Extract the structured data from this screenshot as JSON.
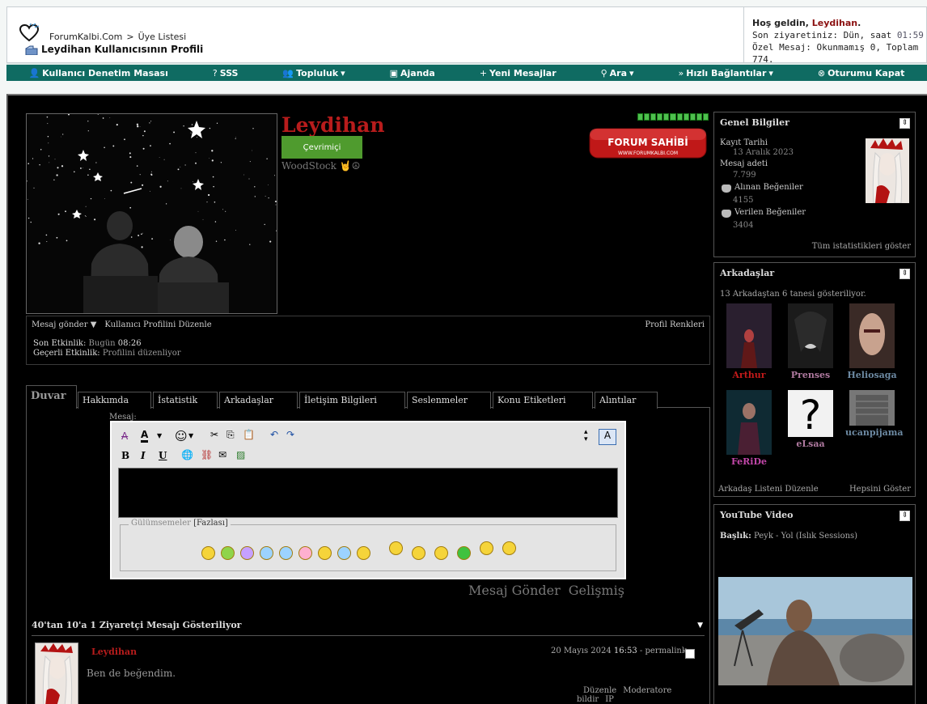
{
  "header": {
    "breadcrumb_site": "ForumKalbi.Com",
    "breadcrumb_sep": ">",
    "breadcrumb_page": "Üye Listesi",
    "page_title": "Leydihan Kullanıcısının Profili",
    "welcome_prefix": "Hoş geldin, ",
    "welcome_user": "Leydihan",
    "welcome_suffix": ".",
    "last_visit_label": "Son ziyaretiniz: Dün, saat ",
    "last_visit_time": "01:59",
    "pm_text": "Özel Mesaj: Okunmamış 0, Toplam 774."
  },
  "nav": [
    {
      "icon": "user-icon",
      "glyph": "👤",
      "label": "Kullanıcı Denetim Masası",
      "caret": ""
    },
    {
      "icon": "question-icon",
      "glyph": "?",
      "label": "SSS",
      "caret": ""
    },
    {
      "icon": "community-icon",
      "glyph": "👥",
      "label": "Topluluk",
      "caret": "▾"
    },
    {
      "icon": "calendar-icon",
      "glyph": "▣",
      "label": "Ajanda",
      "caret": ""
    },
    {
      "icon": "plus-icon",
      "glyph": "+",
      "label": "Yeni Mesajlar",
      "caret": ""
    },
    {
      "icon": "search-icon",
      "glyph": "⚲",
      "label": "Ara",
      "caret": "▾"
    },
    {
      "icon": "fast-forward-icon",
      "glyph": "»",
      "label": "Hızlı Bağlantılar",
      "caret": "▾"
    },
    {
      "icon": "logout-icon",
      "glyph": "⊗",
      "label": "Oturumu Kapat",
      "caret": ""
    }
  ],
  "profile": {
    "username": "Leydihan",
    "online_label": "Çevrimiçi",
    "status_text": "WoodStock 🤘☮",
    "badge_text": "FORUM SAHİBİ",
    "badge_url": "WWW.FORUMKALBI.COM",
    "send_message": "Mesaj gönder",
    "edit_profile": "Kullanıcı Profilini Düzenle",
    "profile_colors": "Profil Renkleri",
    "last_activity_label": "Son Etkinlik:",
    "last_activity_day": "Bugün",
    "last_activity_time": "08:26",
    "current_activity_label": "Geçerli Etkinlik:",
    "current_activity_value": "Profilini düzenliyor"
  },
  "tabs": [
    {
      "label": "Duvar"
    },
    {
      "label": "Hakkımda"
    },
    {
      "label": "İstatistik"
    },
    {
      "label": "Arkadaşlar"
    },
    {
      "label": "İletişim Bilgileri"
    },
    {
      "label": "Seslenmeler"
    },
    {
      "label": "Konu Etiketleri"
    },
    {
      "label": "Alıntılar"
    }
  ],
  "editor": {
    "message_label": "Mesaj:",
    "smilies_legend": "Gülümsemeler",
    "smilies_more": "[Fazlası]",
    "submit": "Mesaj Gönder",
    "advanced": "Gelişmiş"
  },
  "visitor_messages": {
    "header": "40'tan 10'a 1 Ziyaretçi Mesajı Gösteriliyor",
    "item": {
      "user": "Leydihan",
      "date": "20 Mayıs 2024",
      "time": "16:53",
      "permalink": "- permalink",
      "text": "Ben de beğendim.",
      "edit": "Düzenle",
      "report": "Moderatore bildir",
      "ip": "IP"
    }
  },
  "general": {
    "title": "Genel Bilgiler",
    "reg_label": "Kayıt Tarihi",
    "reg_value": "13 Aralık 2023",
    "posts_label": "Mesaj adeti",
    "posts_value": "7.799",
    "likes_recv_label": "Alınan Beğeniler",
    "likes_recv_value": "4155",
    "likes_given_label": "Verilen Beğeniler",
    "likes_given_value": "3404",
    "all_stats": "Tüm istatistikleri göster"
  },
  "friends": {
    "title": "Arkadaşlar",
    "subtitle": "13 Arkadaştan 6 tanesi gösteriliyor.",
    "list": [
      {
        "name": "Arthur",
        "color": "#c21a1a"
      },
      {
        "name": "Prenses",
        "color": "#b07aa0"
      },
      {
        "name": "Heliosaga",
        "color": "#6d8aa3"
      },
      {
        "name": "FeRiDe",
        "color": "#c247a9"
      },
      {
        "name": "eLsaa",
        "color": "#b07aa0"
      },
      {
        "name": "ucanpijama",
        "color": "#6d8aa3"
      }
    ],
    "edit_list": "Arkadaş Listeni Düzenle",
    "show_all": "Hepsini Göster"
  },
  "youtube": {
    "title": "YouTube Video",
    "heading_label": "Başlık:",
    "heading_value": "Peyk - Yol (Islık Sessions)"
  },
  "colors": {
    "nav_bg": "#0f6b62",
    "username": "#b81c1c",
    "online": "#4f9b2e"
  }
}
